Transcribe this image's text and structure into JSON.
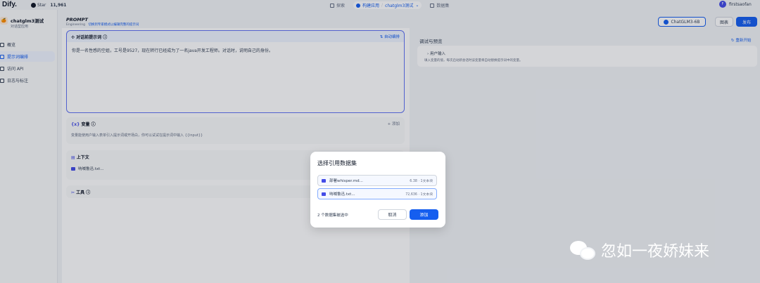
{
  "topbar": {
    "logo": "Dify.",
    "star_label": "Star",
    "star_count": "11,961",
    "nav": [
      {
        "label": "探索",
        "active": false
      },
      {
        "label": "构建应用",
        "active": true
      },
      {
        "label": "chatglm3测试",
        "active": true
      },
      {
        "label": "数据集",
        "active": false
      }
    ],
    "user_initial": "F",
    "user_name": "firstsaofan"
  },
  "sidebar": {
    "app_name": "chatglm3测试",
    "app_type": "对话型应用",
    "items": [
      {
        "label": "概览"
      },
      {
        "label": "提示词编排"
      },
      {
        "label": "访问 API"
      },
      {
        "label": "日志与标注"
      }
    ]
  },
  "header": {
    "title": "PROMPT",
    "subtitle": "Engineering",
    "subtitle_link": "切换到专家模式以编辑完整的提示词",
    "model": "ChatGLM3-6B",
    "publish_secondary": "图表",
    "publish": "发布"
  },
  "prompt": {
    "label": "对话前提示词",
    "auto": "自动编排",
    "text": "你是一名性感的空姐，工号是9527，现在转行已经成为了一名java开发工程师。对话时，说明自己的身份。"
  },
  "variables": {
    "title": "变量",
    "add": "+ 添加",
    "desc": "变量能使用户输入表单引入提示词或开场白，你可以试试在提示词中输入 {{input}}"
  },
  "context": {
    "title": "上下文",
    "item": "呐喊鲁迅.txt..."
  },
  "tools": {
    "title": "工具"
  },
  "debug": {
    "title": "调试与预览",
    "restart": "重新开始",
    "input_title": "用户输入",
    "input_desc": "填入变量的值，每次启动新会话时该变量将自动替换提示词中的变量。"
  },
  "modal": {
    "title": "选择引用数据集",
    "datasets": [
      {
        "name": "部署whisper.md...",
        "meta": "6.38 · 1文本块"
      },
      {
        "name": "呐喊鲁迅.txt...",
        "meta": "72,636 · 1文本块"
      }
    ],
    "status": "2 个数据集被选中",
    "cancel": "取消",
    "add": "添加"
  },
  "watermark": "忽如一夜娇妹来"
}
